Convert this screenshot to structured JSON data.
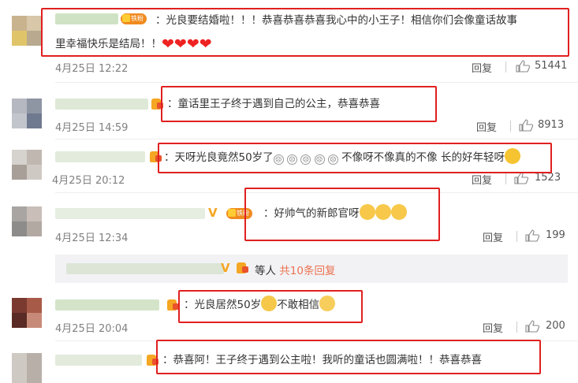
{
  "comments": [
    {
      "text_line1": "：光良要结婚啦！！！恭喜恭喜恭喜我心中的小王子！相信你们会像童话故事",
      "text_line2": "里幸福快乐是结局！！",
      "badge": "铁粉",
      "time": "4月25日 12:22",
      "reply_label": "回复",
      "likes": "51441"
    },
    {
      "text": "：童话里王子终于遇到自己的公主，恭喜恭喜",
      "time": "4月25日 14:59",
      "reply_label": "回复",
      "likes": "8913"
    },
    {
      "text_a": "：天呀光良竟然50岁了",
      "text_b": " 不像呀不像真的不像 长的好年轻呀",
      "time": "4月25日 20:12",
      "reply_label": "回复",
      "likes": "1523"
    },
    {
      "text": "：好帅气的新郎官呀",
      "badge": "铁粉",
      "time": "4月25日 12:34",
      "reply_label": "回复",
      "likes": "199"
    },
    {
      "text_a": "：光良居然50岁",
      "text_b": "不敢相信",
      "time": "4月25日 20:04",
      "reply_label": "回复",
      "likes": "200"
    },
    {
      "text": "：恭喜阿！王子终于遇到公主啦！我听的童话也圆满啦！！恭喜恭喜"
    }
  ],
  "sub_replies": {
    "prefix": "等人",
    "link": "共10条回复"
  },
  "colors": {
    "highlight_box": "#e02020",
    "link": "#eb7350",
    "vip": "#f5a623"
  }
}
